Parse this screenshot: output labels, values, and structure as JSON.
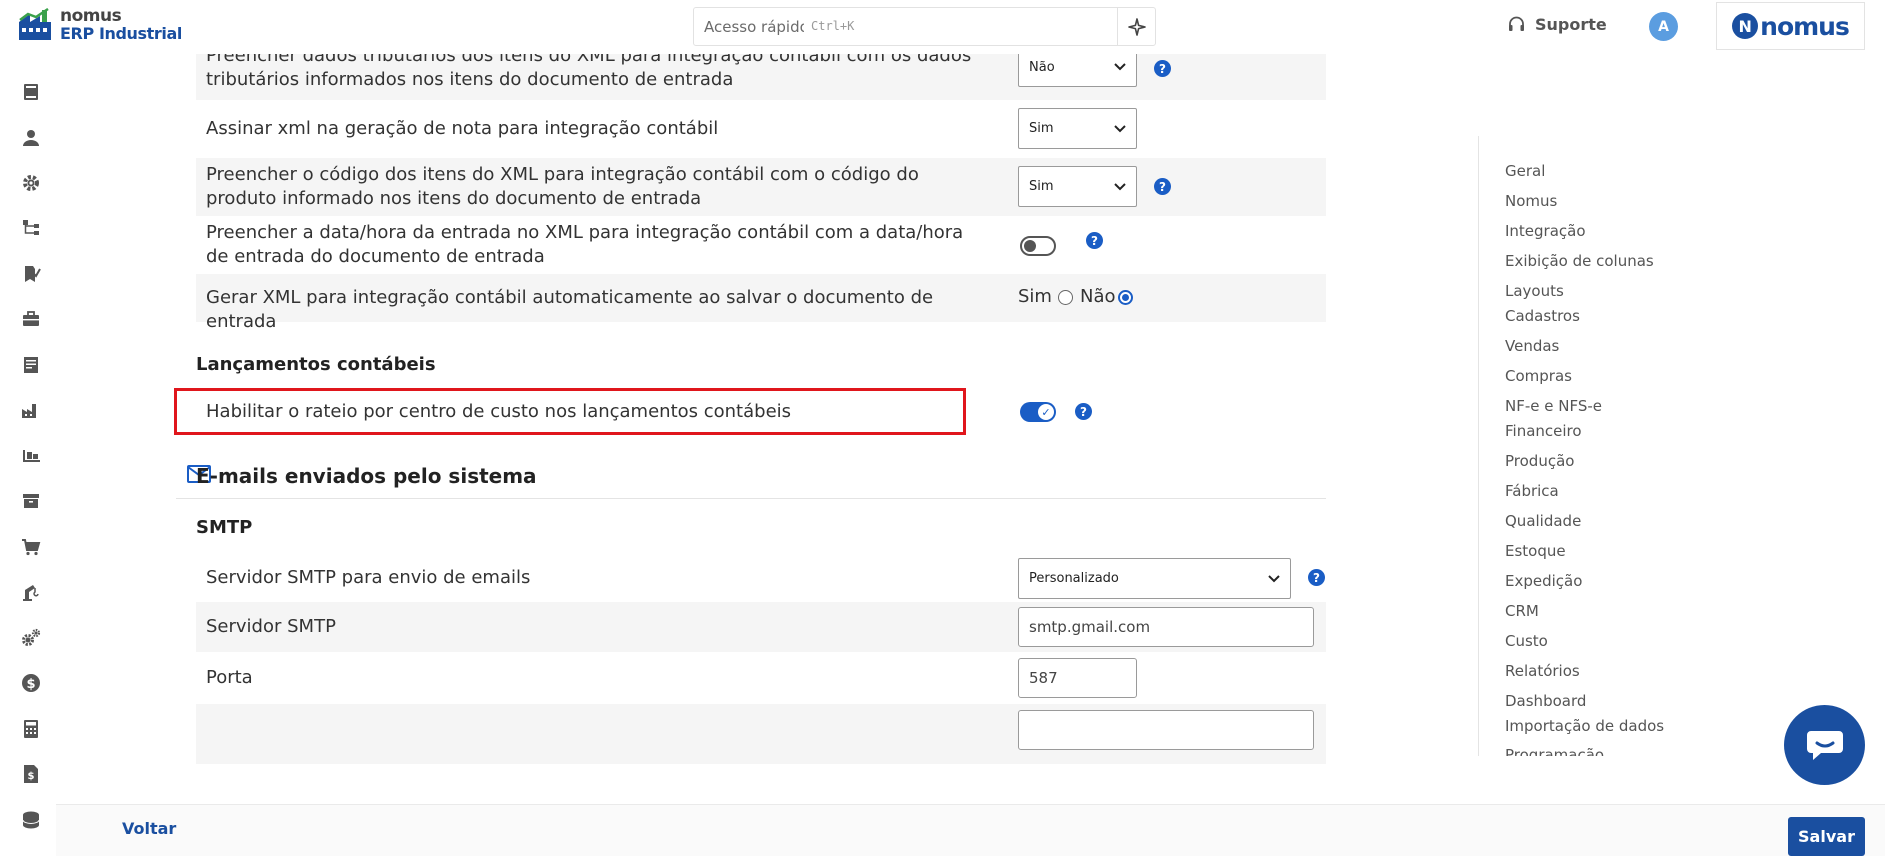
{
  "header": {
    "logo_line1": "nomus",
    "logo_line2": "ERP Industrial",
    "search_placeholder": "Acesso rápido",
    "search_shortcut": "Ctrl+K",
    "support_label": "Suporte",
    "avatar_initial": "A",
    "brand_text": "nomus",
    "brand_mark": "N"
  },
  "rail": {
    "icons": [
      "book-icon",
      "user-icon",
      "gear-icon",
      "hierarchy-icon",
      "tasks-icon",
      "briefcase-icon",
      "document-icon",
      "factory-icon",
      "forklift-icon",
      "archive-icon",
      "cart-icon",
      "crane-icon",
      "gears-icon",
      "dollar-icon",
      "calculator-icon",
      "invoice-icon",
      "database-icon"
    ]
  },
  "settings": {
    "row1_label": "Preencher dados tributários dos itens do XML para integração contábil com os dados tributários informados nos itens do documento de entrada",
    "row1_value": "Não",
    "row2_label": "Assinar xml na geração de nota para integração contábil",
    "row2_value": "Sim",
    "row3_label": "Preencher o código dos itens do XML para integração contábil com o código do produto informado nos itens do documento de entrada",
    "row3_value": "Sim",
    "row4_label": "Preencher a data/hora da entrada no XML para integração contábil com a data/hora de entrada do documento de entrada",
    "row5_label": "Gerar XML para integração contábil automaticamente ao salvar o documento de entrada",
    "row5_opt_yes": "Sim",
    "row5_opt_no": "Não",
    "lanc_heading": "Lançamentos contábeis",
    "rateio_label": "Habilitar o rateio por centro de custo nos lançamentos contábeis",
    "rateio_check": "✓",
    "help_glyph": "?",
    "emails_heading": "E-mails enviados pelo sistema",
    "smtp_heading": "SMTP",
    "smtp_server_type_label": "Servidor SMTP para envio de emails",
    "smtp_server_type_value": "Personalizado",
    "smtp_server_label": "Servidor SMTP",
    "smtp_server_value": "smtp.gmail.com",
    "port_label": "Porta",
    "port_value": "587"
  },
  "rightnav": {
    "items": [
      "Geral",
      "Nomus",
      "Integração",
      "Exibição de colunas",
      "Layouts",
      "Cadastros",
      "Vendas",
      "Compras",
      "NF-e e NFS-e",
      "Financeiro",
      "Produção",
      "Fábrica",
      "Qualidade",
      "Estoque",
      "Expedição",
      "CRM",
      "Custo",
      "Relatórios",
      "Dashboard",
      "Importação de dados",
      "Programação"
    ]
  },
  "footer": {
    "back_label": "Voltar",
    "save_label": "Salvar"
  },
  "colors": {
    "brand": "#1a4fa0",
    "accent": "#1a5dc5",
    "highlight": "#e0161c"
  }
}
